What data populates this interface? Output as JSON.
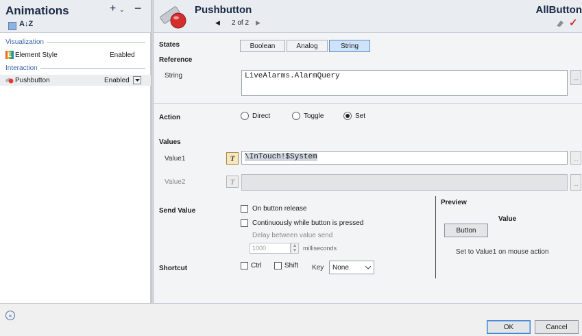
{
  "left": {
    "title": "Animations",
    "add_symbol": "+",
    "add_caret": "⌄",
    "remove_symbol": "−",
    "sort_symbol": "A↓Z",
    "groups": [
      {
        "label": "Visualization",
        "items": [
          {
            "label": "Element Style",
            "status": "Enabled"
          }
        ]
      },
      {
        "label": "Interaction",
        "items": [
          {
            "label": "Pushbutton",
            "status": "Enabled"
          }
        ]
      }
    ]
  },
  "header": {
    "title": "Pushbutton",
    "pager": "2 of 2",
    "right_title": "AllButton"
  },
  "states": {
    "label": "States",
    "options": [
      "Boolean",
      "Analog",
      "String"
    ],
    "active": "String"
  },
  "reference": {
    "label": "Reference",
    "string_label": "String",
    "value": "LiveAlarms.AlarmQuery",
    "browse_label": "..."
  },
  "action": {
    "label": "Action",
    "options": [
      "Direct",
      "Toggle",
      "Set"
    ],
    "selected": "Set"
  },
  "values": {
    "label": "Values",
    "value1_label": "Value1",
    "value1": "\\InTouch!$System",
    "value2_label": "Value2",
    "value2": "",
    "browse_label": "..."
  },
  "send_value": {
    "label": "Send Value",
    "on_release": "On button release",
    "continuously": "Continuously while button is pressed",
    "delay_label": "Delay between value send",
    "delay_value": "1000",
    "delay_unit": "milliseconds"
  },
  "shortcut": {
    "label": "Shortcut",
    "ctrl": "Ctrl",
    "shift": "Shift",
    "key_label": "Key",
    "key_value": "None"
  },
  "preview": {
    "label": "Preview",
    "value_label": "Value",
    "button_label": "Button",
    "description": "Set to Value1 on mouse action"
  },
  "footer": {
    "ok": "OK",
    "cancel": "Cancel"
  }
}
